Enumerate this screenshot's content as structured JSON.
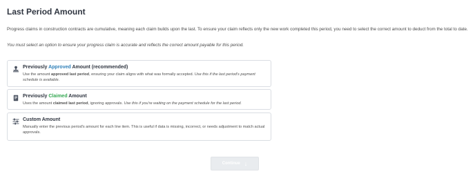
{
  "page_title": "Last Period Amount",
  "intro_text": "Progress claims in construction contracts are cumulative, meaning each claim builds upon the last. To ensure your claim reflects only the new work completed this period, you need to select the correct amount to deduct from the total to date.",
  "notice_text": "You must select an option to ensure your progress claim is accurate and reflects the correct amount payable for this period.",
  "options": [
    {
      "icon": "approval-stamp-icon",
      "title_before": "Previously ",
      "title_highlight": "Approved",
      "title_after": " Amount (recommended)",
      "desc_before": "Use the amount ",
      "desc_strong": "approved last period",
      "desc_middle": ", ensuring your claim aligns with what was formally accepted. ",
      "desc_italic": "Use this if the last period's payment schedule is available."
    },
    {
      "icon": "document-icon",
      "title_before": "Previously ",
      "title_highlight": "Claimed",
      "title_after": " Amount",
      "desc_before": "Uses the amount ",
      "desc_strong": "claimed last period",
      "desc_middle": ", ignoring approvals. ",
      "desc_italic": "Use this if you're waiting on the payment schedule for the last period."
    },
    {
      "icon": "sliders-icon",
      "title": "Custom Amount",
      "desc": "Manually enter the previous period's amount for each line item. This is useful if data is missing, incorrect, or needs adjustment to match actual approvals."
    }
  ],
  "continue_label": "Continue",
  "colors": {
    "approved_highlight": "#2e7fb8",
    "claimed_highlight": "#35a852",
    "button_disabled_bg": "#e9ecef"
  }
}
